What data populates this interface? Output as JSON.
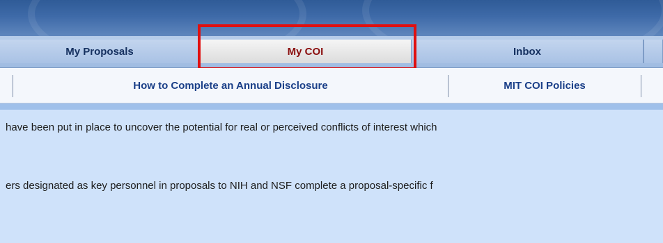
{
  "tabs": [
    {
      "label": "My Proposals"
    },
    {
      "label": "My COI",
      "active": true
    },
    {
      "label": "Inbox"
    },
    {
      "label": ""
    }
  ],
  "subnav": {
    "links": [
      {
        "label": "How to Complete an Annual Disclosure"
      },
      {
        "label": "MIT COI Policies"
      }
    ]
  },
  "content": {
    "paragraphs": [
      "have been put in place to uncover the potential for real or perceived conflicts of interest which",
      "ers designated as key personnel in proposals to NIH and NSF complete a proposal-specific f"
    ]
  },
  "colors": {
    "active_tab_text": "#8a0d0d",
    "tab_text": "#15305f",
    "link_text": "#1a3f88",
    "highlight_box": "#e01010"
  }
}
